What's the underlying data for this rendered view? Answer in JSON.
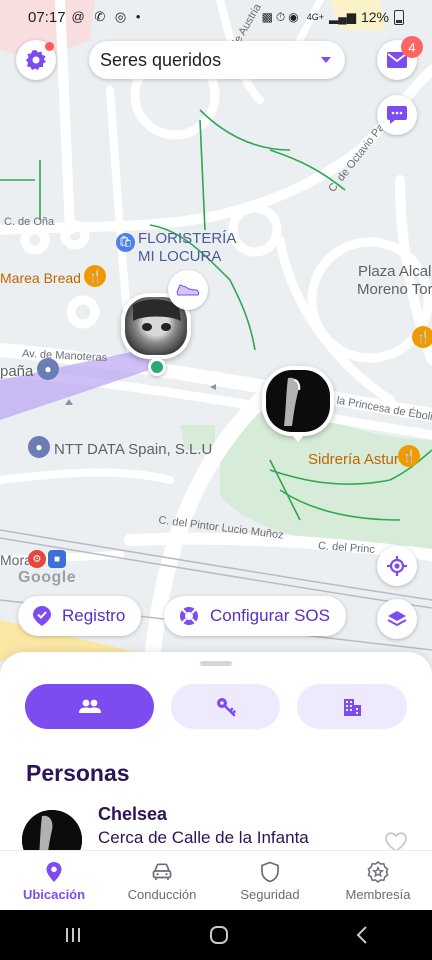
{
  "status_bar": {
    "time": "07:17",
    "left_icons": "@ ✆ ◎ •",
    "signal_text": "4G+",
    "battery": "12%"
  },
  "header": {
    "group_selector": "Seres queridos",
    "messages_count": "4"
  },
  "map_labels": {
    "floristeria_line1": "FLORISTERÍA",
    "floristeria_line2": "MI LOCURA",
    "marea": "Marea Bread",
    "ntt": "NTT DATA Spain, S.L.U",
    "plaza_line1": "Plaza Alcal",
    "plaza_line2": "Moreno Tor",
    "sidreria": "Sidrería Astur",
    "espana": "paña",
    "mora": "Mora",
    "google": "Google",
    "street_ona": "C. de Oña",
    "street_manoteras": "Av. de Manoteras",
    "street_octavio": "C. de Octavio Paz",
    "street_austria": "de Austria",
    "street_eboli": "la Princesa de Éboli",
    "street_pintor": "C. del Pintor Lucio Muñoz",
    "street_principe": "C. del Princ"
  },
  "actions": {
    "registro": "Registro",
    "sos": "Configurar SOS"
  },
  "sheet": {
    "section_title": "Personas",
    "people": [
      {
        "name": "Chelsea",
        "location": "Cerca de Calle de la Infanta"
      }
    ]
  },
  "bottom_nav": [
    {
      "label": "Ubicación",
      "icon": "location-pin-icon",
      "active": true
    },
    {
      "label": "Conducción",
      "icon": "car-icon",
      "active": false
    },
    {
      "label": "Seguridad",
      "icon": "shield-icon",
      "active": false
    },
    {
      "label": "Membresía",
      "icon": "star-badge-icon",
      "active": false
    }
  ],
  "colors": {
    "accent": "#7d4cf0",
    "accent_light": "#efe9fd",
    "title": "#2d1458",
    "badge": "#ff6464",
    "park": "#d6ecd8"
  }
}
